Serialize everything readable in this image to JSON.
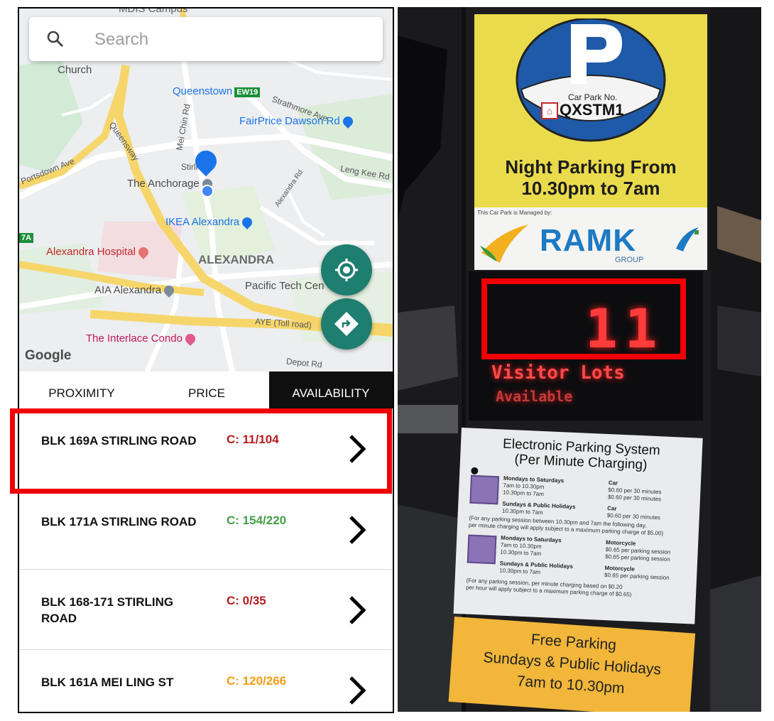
{
  "search": {
    "placeholder": "Search"
  },
  "map": {
    "labels": {
      "campus": "MDIS Campus",
      "church": "Church",
      "queenstown": "Queenstown",
      "mrt_code": "EW19",
      "strathmore": "Strathmore Ave",
      "fairprice": "FairPrice Dawson Rd",
      "mei_chin": "Mei Chin Rd",
      "queensway": "Queensway",
      "portsdown": "Portsdown Ave",
      "stirling": "Stirli",
      "anchorage": "The Anchorage",
      "leng_kee": "Leng Kee Rd",
      "alexandra_rd": "Alexandra Rd",
      "ikea": "IKEA Alexandra",
      "mrt_7a": "7A",
      "hospital": "Alexandra Hospital",
      "alexandra": "ALEXANDRA",
      "pacific": "Pacific Tech Cen",
      "aia": "AIA Alexandra",
      "aye": "AYE (Toll road)",
      "interlace": "The Interlace Condo",
      "depot": "Depot Rd",
      "google": "Google"
    }
  },
  "tabs": [
    {
      "label": "PROXIMITY",
      "active": false
    },
    {
      "label": "PRICE",
      "active": false
    },
    {
      "label": "AVAILABILITY",
      "active": true
    }
  ],
  "carparks": [
    {
      "name": "BLK 169A STIRLING ROAD",
      "count": "C: 11/104",
      "color": "#b71c1c"
    },
    {
      "name": "BLK 171A STIRLING ROAD",
      "count": "C: 154/220",
      "color": "#43a047"
    },
    {
      "name": "BLK 168-171 STIRLING ROAD",
      "count": "C: 0/35",
      "color": "#b71c1c"
    },
    {
      "name": "BLK 161A MEI LING ST",
      "count": "C: 120/266",
      "color": "#f39c12"
    }
  ],
  "photo": {
    "car_park_no_label": "Car Park No.",
    "car_park_no": "QXSTM1",
    "night_parking": [
      "Night Parking From",
      "10.30pm to 7am"
    ],
    "managed_by": "This Car Park is Managed by:",
    "ramk": "RAMK",
    "ramk_group": "GROUP",
    "led_count": "11",
    "led_line1": "Visitor Lots",
    "led_line2": "Available",
    "eps_title": [
      "Electronic Parking System",
      "(Per Minute Charging)"
    ],
    "eps": {
      "mon_sat": "Mondays to Saturdays",
      "day": "7am to 10.30pm",
      "night": "10.30pm to 7am",
      "car": "Car",
      "car_rate_1": "$0.60 per 30 minutes",
      "car_rate_2": "$0.60 per 30 minutes",
      "sun_ph": "Sundays & Public Holidays",
      "sun_time": "10.30pm to 7am",
      "car_rate_3": "$0.60 per 30 minutes",
      "note1": "(For any parking session between 10.30pm and 7am the following day,",
      "note2": "per minute charging will apply subject to a maximum parking charge of $5.00)",
      "moto_mon_sat": "Mondays to Saturdays",
      "moto_day": "7am to 10.30pm",
      "moto_night": "10.30pm to 7am",
      "motorcycle": "Motorcycle",
      "moto_rate_1": "$0.65 per parking session",
      "moto_rate_2": "$0.65 per parking session",
      "moto_sun_ph": "Sundays & Public Holidays",
      "moto_sun_time": "10.30pm to 7am",
      "moto_rate_3": "$0.65 per parking session",
      "note3": "(For any parking session, per minute charging based on $0.20",
      "note4": "per hour will apply subject to a maximum parking charge of $0.65)"
    },
    "free_parking": [
      "Free Parking",
      "Sundays & Public Holidays",
      "7am to 10.30pm"
    ]
  },
  "colors": {
    "fab": "#1e7e6f",
    "highlight": "#f00000",
    "led": "#ff3b3b",
    "tab_active_bg": "#0f0f0f"
  }
}
